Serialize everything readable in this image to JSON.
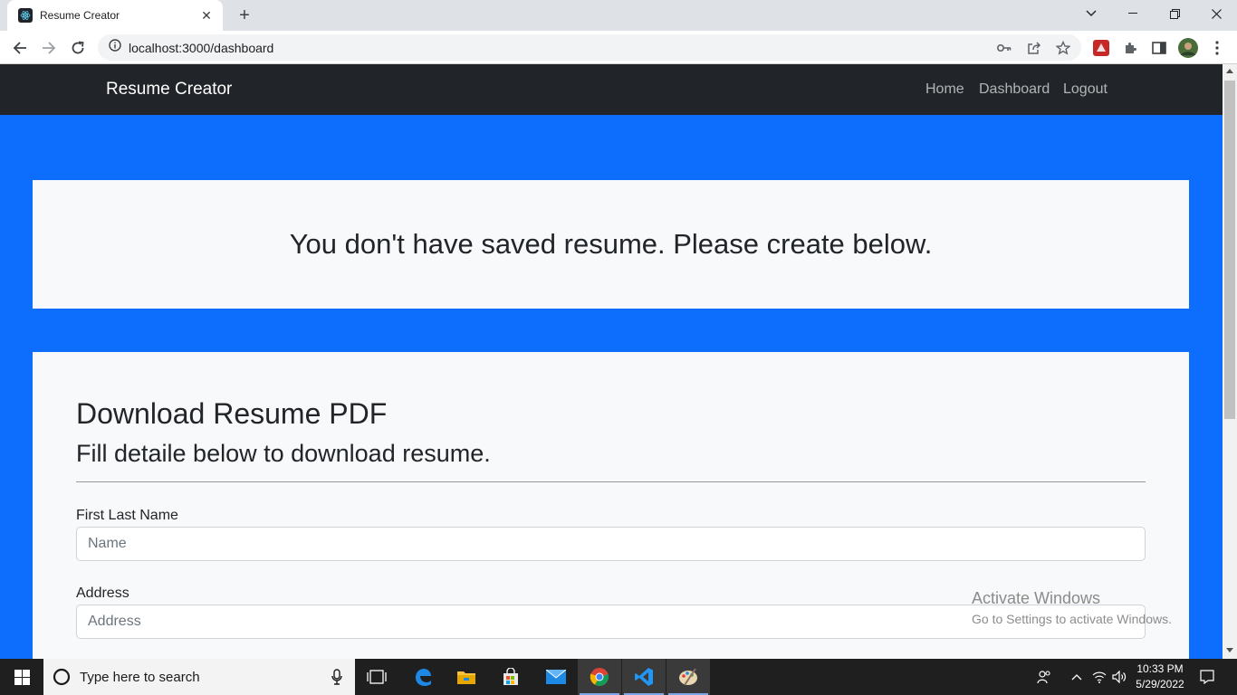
{
  "browser": {
    "tab_title": "Resume Creator",
    "url": "localhost:3000/dashboard"
  },
  "navbar": {
    "brand": "Resume Creator",
    "links": [
      "Home",
      "Dashboard",
      "Logout"
    ]
  },
  "alert": {
    "message": "You don't have saved resume. Please create below."
  },
  "form": {
    "heading": "Download Resume PDF",
    "subheading": "Fill detaile below to download resume.",
    "fields": [
      {
        "label": "First Last Name",
        "placeholder": "Name",
        "value": ""
      },
      {
        "label": "Address",
        "placeholder": "Address",
        "value": ""
      }
    ]
  },
  "watermark": {
    "title": "Activate Windows",
    "subtitle": "Go to Settings to activate Windows."
  },
  "taskbar": {
    "search_placeholder": "Type here to search",
    "time": "10:33 PM",
    "date": "5/29/2022",
    "apps": [
      "task-view",
      "edge",
      "file-explorer",
      "store",
      "mail",
      "chrome",
      "vscode",
      "paint"
    ]
  },
  "colors": {
    "page_background": "#0d6efd",
    "navbar": "#212529",
    "card": "#f8f9fa"
  }
}
